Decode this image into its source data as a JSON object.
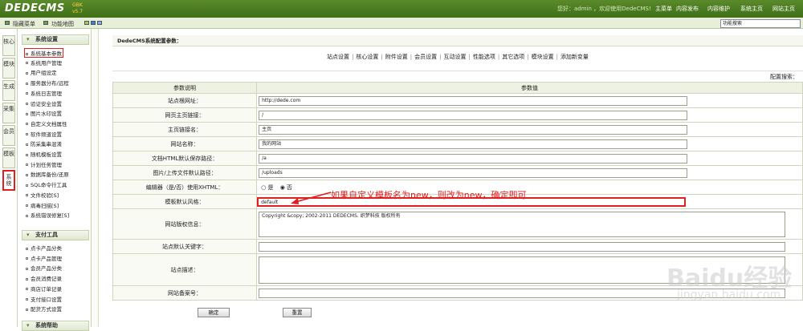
{
  "app": {
    "logo": "DEDECMS",
    "version": "v5.7",
    "version_tag": "GBK"
  },
  "topbar": {
    "welcome": "您好：admin ，欢迎使用DedeCMS!",
    "nav": [
      "主菜单",
      "内容发布",
      "内容维护",
      "系统主页",
      "网站主页"
    ]
  },
  "bar2": {
    "hide_menu": "隐藏菜单",
    "site_map": "功能地图",
    "search_placeholder": "功能搜索"
  },
  "tabs": [
    "核心",
    "模块",
    "生成",
    "采集",
    "会员",
    "模板",
    "系统"
  ],
  "sidebar": {
    "sec1": "系统设置",
    "items1": [
      "系统基本参数",
      "系统用户管理",
      "用户组设定",
      "服务器分布/远程",
      "系统日志管理",
      "验证安全设置",
      "图片水印设置",
      "自定义文档属性",
      "软件频道设置",
      "防采集串混淆",
      "随机模板设置",
      "计划任务管理",
      "数据库备份/还原",
      "SQL命令行工具",
      "文件校验[S]",
      "病毒扫描[S]",
      "系统错误修复[S]"
    ],
    "sec2": "支付工具",
    "items2": [
      "点卡产品分类",
      "点卡产品管理",
      "会员产品分类",
      "会员消费记录",
      "商店订单记录",
      "支付接口设置",
      "配货方式设置"
    ],
    "sec3": "系统帮助"
  },
  "main": {
    "title": "DedeCMS系统配置参数：",
    "tabs": [
      "站点设置",
      "核心设置",
      "附件设置",
      "会员设置",
      "互动设置",
      "性能选项",
      "其它选项",
      "模块设置",
      "添加新变量"
    ],
    "search_label": "配置搜索：",
    "header_name": "参数说明",
    "header_value": "参数值",
    "rows": [
      {
        "label": "站点根网址：",
        "value": "http://dede.com"
      },
      {
        "label": "网页主页链接：",
        "value": "/"
      },
      {
        "label": "主页链接名：",
        "value": "主页"
      },
      {
        "label": "网站名称：",
        "value": "我的网站"
      },
      {
        "label": "文档HTML默认保存路径：",
        "value": "/a"
      },
      {
        "label": "图片/上传文件默认路径：",
        "value": "/uploads"
      }
    ],
    "editor_label": "编辑器（是/否）使用XHTML：",
    "radio_yes": "是",
    "radio_no": "否",
    "template_label": "模板默认风格：",
    "template_value": "default",
    "copyright_label": "网站版权信息：",
    "copyright_value": "Copyright &copy; 2002-2011 DEDECMS. 织梦科技 版权所有",
    "keywords_label": "站点默认关键字：",
    "desc_label": "站点描述：",
    "icp_label": "网站备案号：",
    "ok": "确定",
    "reset": "重置"
  },
  "annotation": "如果自定义模板名为new，则改为new，确定即可",
  "watermark": {
    "line1": "Baidu经验",
    "line2": "jingyan.baidu.com"
  }
}
